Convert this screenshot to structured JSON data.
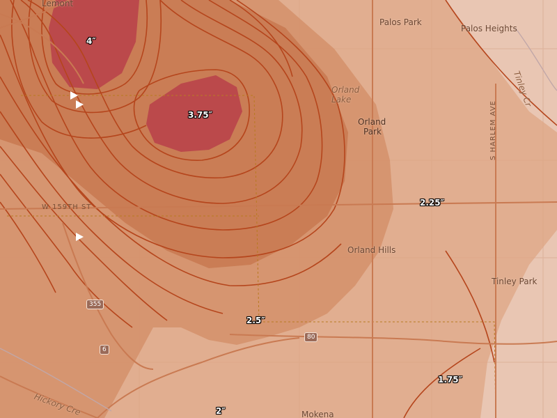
{
  "map": {
    "places": {
      "lemont": "Lemont",
      "palos_park": "Palos Park",
      "palos_heights": "Palos Heights",
      "orland_lake_line1": "Orland",
      "orland_lake_line2": "Lake",
      "orland_park_line1": "Orland",
      "orland_park_line2": "Park",
      "orland_hills": "Orland Hills",
      "tinley_park": "Tinley Park",
      "mokena": "Mokena",
      "tinley_creek": "Tinley Cr",
      "hickory_creek": "Hickory Cre",
      "w_159th_st": "W 159TH ST",
      "s_harlem_ave": "S HARLEM AVE"
    },
    "shields": {
      "i355": "355",
      "i80": "80",
      "us6": "6"
    },
    "amount_labels": {
      "a4": "4″",
      "a375": "3.75″",
      "a225": "2.25″",
      "a25": "2.5″",
      "a175": "1.75″",
      "a2": "2″"
    },
    "colors": {
      "base": "#e9c6b3",
      "band_175": "#dea584",
      "band_2": "#d38f68",
      "band_25": "#c7774f",
      "band_375": "#b8404a",
      "contour": "#b5451c"
    }
  }
}
